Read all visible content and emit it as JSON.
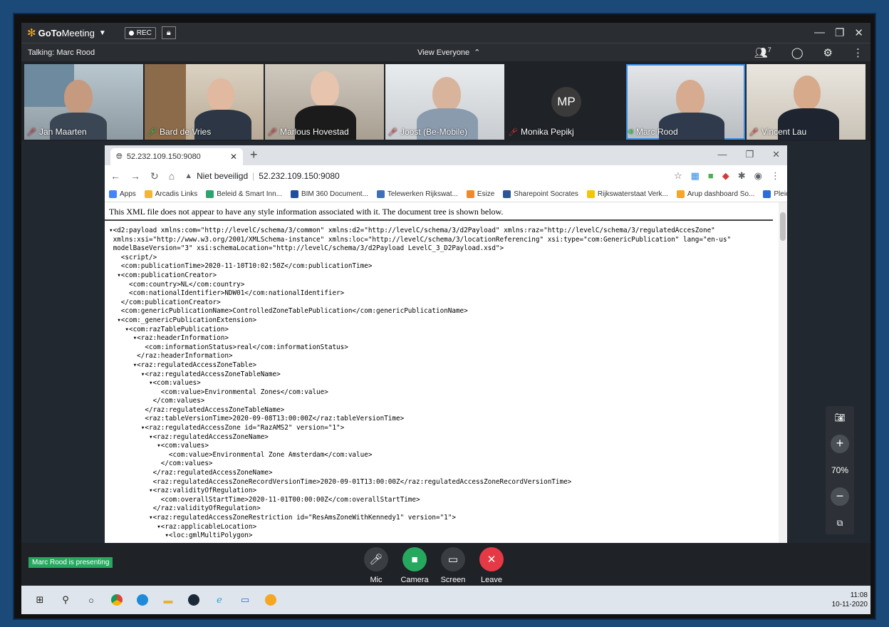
{
  "app": {
    "brand_goto": "GoTo",
    "brand_meeting": "Meeting",
    "rec_label": "REC"
  },
  "infobar": {
    "talking": "Talking: Marc Rood",
    "view": "View Everyone",
    "attendee_count": "7"
  },
  "participants": [
    {
      "name": "Jan Maarten",
      "mic": "off"
    },
    {
      "name": "Bard de Vries",
      "mic": "on"
    },
    {
      "name": "Marlous Hovestad",
      "mic": "off"
    },
    {
      "name": "Joost (Be-Mobile)",
      "mic": "off"
    },
    {
      "name": "Monika Pepikj",
      "mic": "off",
      "initials": "MP"
    },
    {
      "name": "Marc Rood",
      "mic": "on"
    },
    {
      "name": "Vincent Lau",
      "mic": "off"
    }
  ],
  "browser": {
    "tab_title": "52.232.109.150:9080",
    "security": "Niet beveiligd",
    "url": "52.232.109.150:9080",
    "bookmarks": [
      {
        "label": "Apps",
        "color": "#4285f4"
      },
      {
        "label": "Arcadis Links",
        "color": "#f2b632"
      },
      {
        "label": "Beleid & Smart Inn...",
        "color": "#2ea36e"
      },
      {
        "label": "BIM 360 Document...",
        "color": "#1f4e9c"
      },
      {
        "label": "Telewerken Rijkswat...",
        "color": "#3f6fb5"
      },
      {
        "label": "Esize",
        "color": "#f08a24"
      },
      {
        "label": "Sharepoint Socrates",
        "color": "#2b5797"
      },
      {
        "label": "Rijkswaterstaat Verk...",
        "color": "#f2c600"
      },
      {
        "label": "Arup dashboard So...",
        "color": "#f5a623"
      },
      {
        "label": "Pleio",
        "color": "#2b6cd9"
      }
    ],
    "more": "»",
    "notice": "This XML file does not appear to have any style information associated with it. The document tree is shown below."
  },
  "xml_lines": [
    "▾<d2:payload xmlns:com=\"http://levelC/schema/3/common\" xmlns:d2=\"http://levelC/schema/3/d2Payload\" xmlns:raz=\"http://levelC/schema/3/regulatedAccesZone\"",
    " xmlns:xsi=\"http://www.w3.org/2001/XMLSchema-instance\" xmlns:loc=\"http://levelC/schema/3/locationReferencing\" xsi:type=\"com:GenericPublication\" lang=\"en-us\"",
    " modelBaseVersion=\"3\" xsi:schemaLocation=\"http://levelC/schema/3/d2Payload LevelC_3_D2Payload.xsd\">",
    "   <script/>",
    "   <com:publicationTime>2020-11-10T10:02:50Z</com:publicationTime>",
    "  ▾<com:publicationCreator>",
    "     <com:country>NL</com:country>",
    "     <com:nationalIdentifier>NDW01</com:nationalIdentifier>",
    "   </com:publicationCreator>",
    "   <com:genericPublicationName>ControlledZoneTablePublication</com:genericPublicationName>",
    "  ▾<com:_genericPublicationExtension>",
    "    ▾<com:razTablePublication>",
    "      ▾<raz:headerInformation>",
    "         <com:informationStatus>real</com:informationStatus>",
    "       </raz:headerInformation>",
    "      ▾<raz:regulatedAccessZoneTable>",
    "        ▾<raz:regulatedAccessZoneTableName>",
    "          ▾<com:values>",
    "             <com:value>Environmental Zones</com:value>",
    "           </com:values>",
    "         </raz:regulatedAccessZoneTableName>",
    "         <raz:tableVersionTime>2020-09-08T13:00:00Z</raz:tableVersionTime>",
    "        ▾<raz:regulatedAccessZone id=\"RazAMS2\" version=\"1\">",
    "          ▾<raz:regulatedAccessZoneName>",
    "            ▾<com:values>",
    "               <com:value>Environmental Zone Amsterdam</com:value>",
    "             </com:values>",
    "           </raz:regulatedAccessZoneName>",
    "           <raz:regulatedAccessZoneRecordVersionTime>2020-09-01T13:00:00Z</raz:regulatedAccessZoneRecordVersionTime>",
    "          ▾<raz:validityOfRegulation>",
    "             <com:overallStartTime>2020-11-01T00:00:00Z</com:overallStartTime>",
    "           </raz:validityOfRegulation>",
    "          ▾<raz:regulatedAccessZoneRestriction id=\"ResAmsZoneWithKennedy1\" version=\"1\">",
    "            ▾<raz:applicableLocation>",
    "              ▾<loc:gmlMultiPolygon>"
  ],
  "zoom": {
    "percent": "70%"
  },
  "bottom": {
    "presenting": "Marc Rood is presenting",
    "controls": [
      {
        "label": "Mic",
        "color": "#3a3d42"
      },
      {
        "label": "Camera",
        "color": "#27a85f"
      },
      {
        "label": "Screen",
        "color": "#3a3d42"
      },
      {
        "label": "Leave",
        "color": "#e63946"
      }
    ]
  },
  "taskbar": {
    "time": "11:08",
    "date": "10-11-2020"
  }
}
